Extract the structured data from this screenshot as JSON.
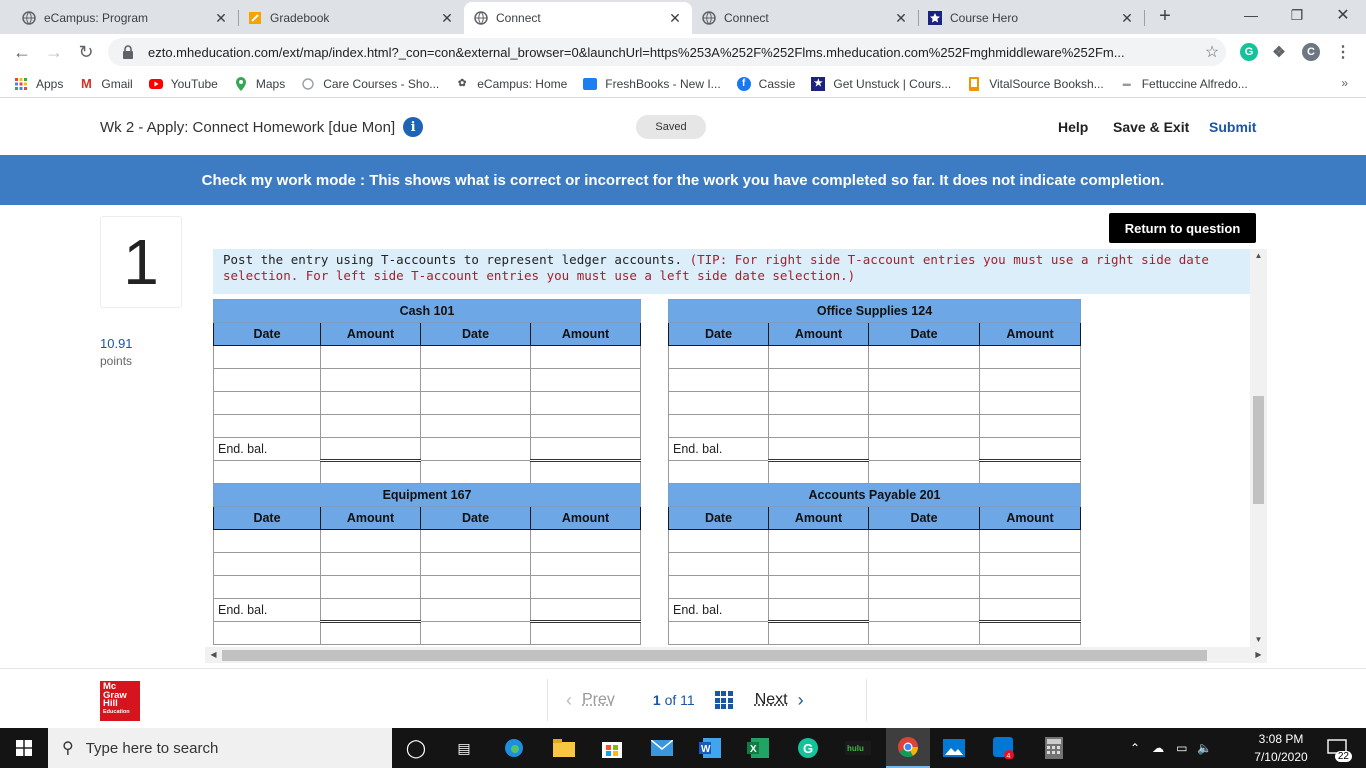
{
  "browser": {
    "tabs": [
      {
        "title": "eCampus: Program",
        "icon": "globe-icon",
        "active": false
      },
      {
        "title": "Gradebook",
        "icon": "gradebook-icon",
        "active": false
      },
      {
        "title": "Connect",
        "icon": "globe-icon",
        "active": true
      },
      {
        "title": "Connect",
        "icon": "globe-icon",
        "active": false
      },
      {
        "title": "Course Hero",
        "icon": "coursehero-icon",
        "active": false
      }
    ],
    "url": "ezto.mheducation.com/ext/map/index.html?_con=con&external_browser=0&launchUrl=https%253A%252F%252Flms.mheducation.com%252Fmghmiddleware%252Fm...",
    "profile_initial": "C",
    "bookmarks": [
      {
        "label": "Apps",
        "icon": "apps-icon",
        "color": "#e8453c"
      },
      {
        "label": "Gmail",
        "icon": "gmail-icon",
        "color": "#d93025"
      },
      {
        "label": "YouTube",
        "icon": "youtube-icon",
        "color": "#ff0000"
      },
      {
        "label": "Maps",
        "icon": "maps-icon",
        "color": "#34a853"
      },
      {
        "label": "Care Courses - Sho...",
        "icon": "globe-icon",
        "color": "#9aa0a6"
      },
      {
        "label": "eCampus: Home",
        "icon": "ecampus-icon",
        "color": "#555"
      },
      {
        "label": "FreshBooks - New I...",
        "icon": "freshbooks-icon",
        "color": "#1d7ef2"
      },
      {
        "label": "Cassie",
        "icon": "facebook-icon",
        "color": "#1877f2"
      },
      {
        "label": "Get Unstuck | Cours...",
        "icon": "coursehero-icon",
        "color": "#1a237e"
      },
      {
        "label": "VitalSource Booksh...",
        "icon": "vitalsource-icon",
        "color": "#f29400"
      },
      {
        "label": "Fettuccine Alfredo...",
        "icon": "recipe-icon",
        "color": "#999"
      }
    ]
  },
  "header": {
    "title": "Wk 2 - Apply: Connect Homework [due Mon]",
    "status": "Saved",
    "help": "Help",
    "save_exit": "Save & Exit",
    "submit": "Submit"
  },
  "banner": "Check my work mode : This shows what is correct or incorrect for the work you have completed so far. It does not indicate completion.",
  "question": {
    "number": "1",
    "points": "10.91",
    "points_label": "points",
    "return_button": "Return to question",
    "instruction": "Post the entry using T-accounts to represent ledger accounts.",
    "tip": "(TIP: For right side T-account entries you must use a right side date selection.  For left side T-account entries you must use a left side date selection.)"
  },
  "columns": {
    "date": "Date",
    "amount": "Amount"
  },
  "end_bal_label": "End. bal.",
  "accounts": [
    {
      "name": "Cash 101"
    },
    {
      "name": "Office Supplies 124"
    },
    {
      "name": "Equipment 167"
    },
    {
      "name": "Accounts Payable 201"
    }
  ],
  "footer": {
    "logo_lines": [
      "Mc",
      "Graw",
      "Hill"
    ],
    "logo_sub": "Education",
    "prev": "Prev",
    "page_current": "1",
    "page_of": "of",
    "page_total": "11",
    "next": "Next"
  },
  "taskbar": {
    "search_placeholder": "Type here to search",
    "time": "3:08 PM",
    "date": "7/10/2020",
    "notifications": "22"
  }
}
